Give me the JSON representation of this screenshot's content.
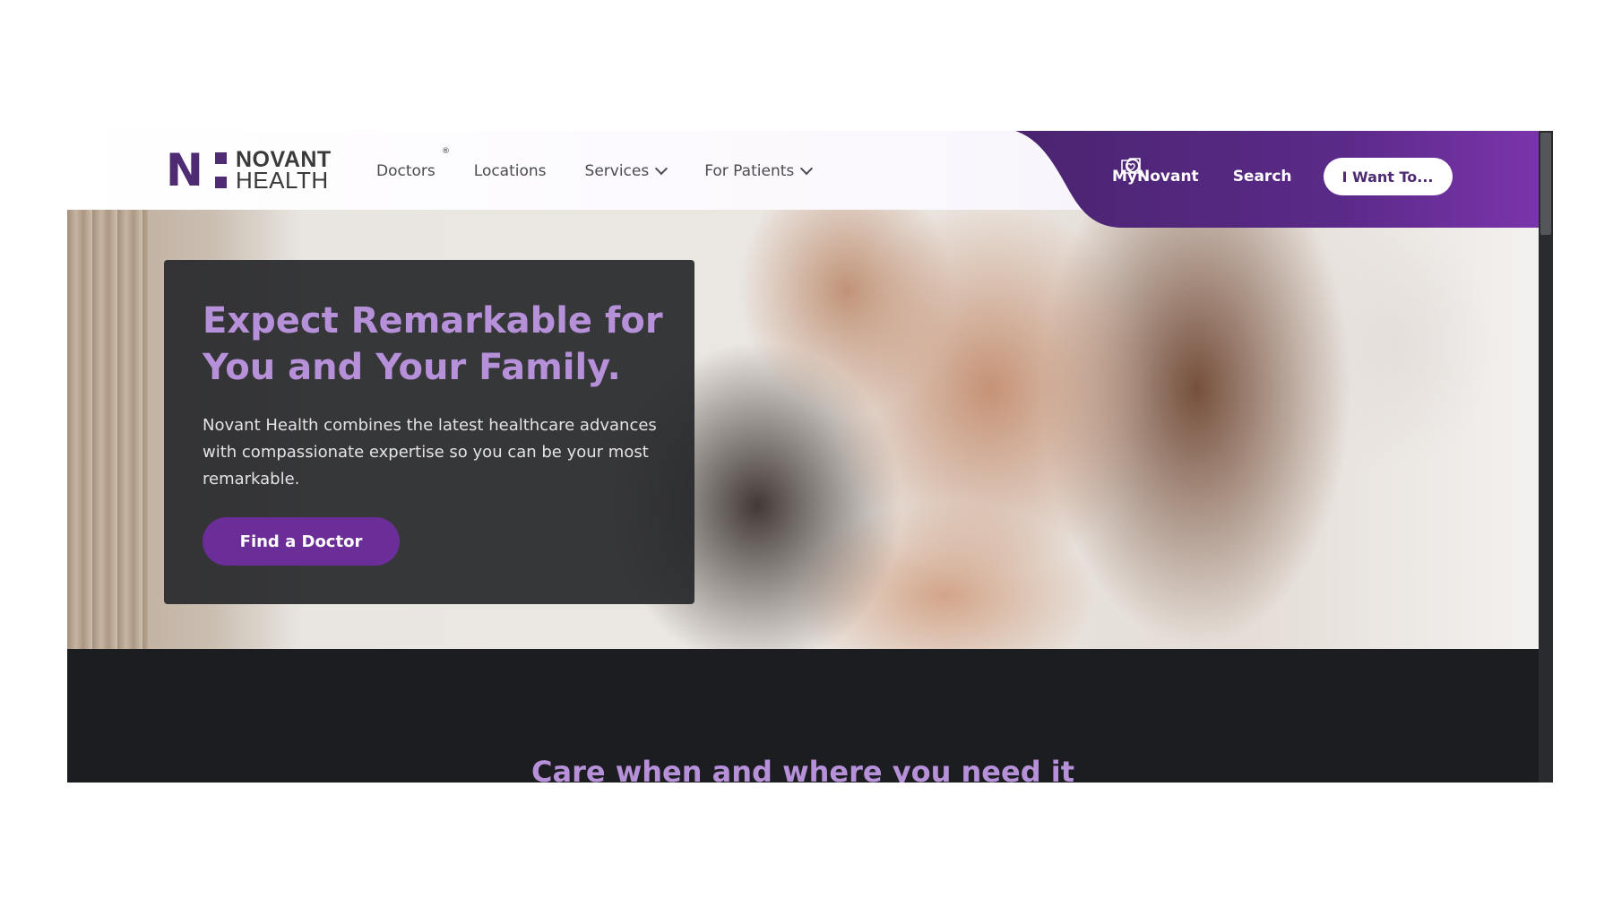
{
  "logo": {
    "line1": "NOVANT",
    "line2": "HEALTH",
    "mark": "N",
    "registered": "®"
  },
  "nav": {
    "items": [
      {
        "label": "Doctors",
        "has_dropdown": false
      },
      {
        "label": "Locations",
        "has_dropdown": false
      },
      {
        "label": "Services",
        "has_dropdown": true
      },
      {
        "label": "For Patients",
        "has_dropdown": true
      }
    ]
  },
  "utility": {
    "mynovant_label": "MyNovant",
    "mynovant_icon": "heart-folder-icon",
    "search_label": "Search",
    "search_icon": "search-icon",
    "iwant_label": "I Want To..."
  },
  "hero": {
    "title": "Expect Remarkable for You and Your Family.",
    "body": "Novant Health combines the latest healthcare advances with compassionate expertise so you can be your most remarkable.",
    "cta_label": "Find a Doctor",
    "image": "mother-daughter-hug-photo"
  },
  "section": {
    "heading": "Care when and where you need it"
  },
  "colors": {
    "brand_purple": "#4e2b73",
    "accent_purple": "#6b2d97",
    "heading_lavender": "#b690d8",
    "dark_bg": "#1c1d20",
    "card_bg": "#28292c"
  }
}
